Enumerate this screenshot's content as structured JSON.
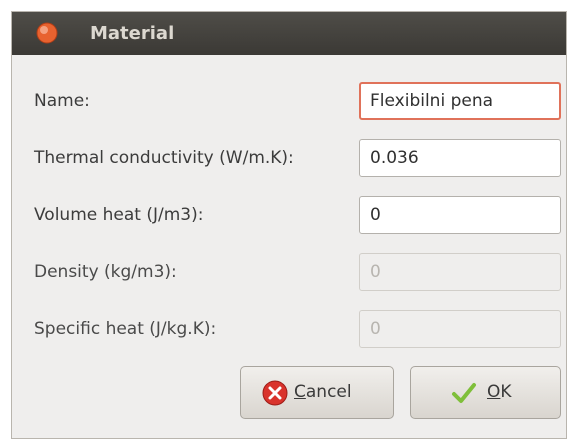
{
  "window": {
    "title": "Material"
  },
  "form": {
    "name": {
      "label": "Name:",
      "value": "Flexibilni pena"
    },
    "thermal_conductivity": {
      "label": "Thermal conductivity (W/m.K):",
      "value": "0.036"
    },
    "volume_heat": {
      "label": "Volume heat (J/m3):",
      "value": "0"
    },
    "density": {
      "label": "Density (kg/m3):",
      "value": "0"
    },
    "specific_heat": {
      "label": "Specific heat (J/kg.K):",
      "value": "0"
    }
  },
  "buttons": {
    "cancel": {
      "mnemonic": "C",
      "rest": "ancel",
      "icon": "cancel-icon"
    },
    "ok": {
      "mnemonic": "O",
      "rest": "K",
      "icon": "checkmark-icon"
    }
  },
  "colors": {
    "titlebar": "#3b3935",
    "focus_border": "#e0725a",
    "cancel_icon": "#d9332c",
    "ok_icon": "#7fbf3a"
  }
}
